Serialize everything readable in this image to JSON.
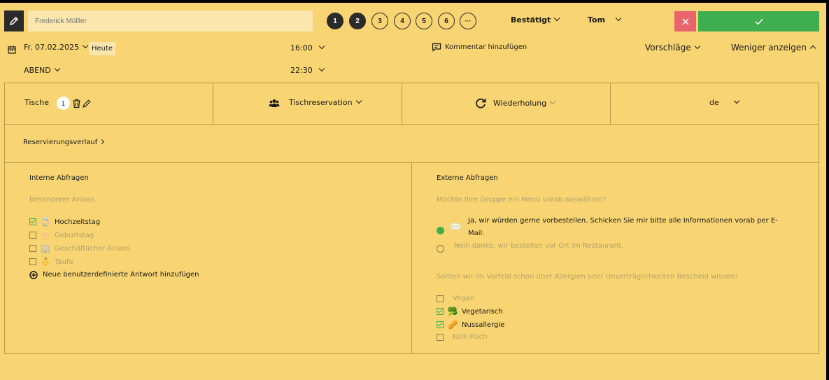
{
  "header": {
    "name_placeholder": "Frederick Mülller",
    "steps": [
      "1",
      "2",
      "3",
      "4",
      "5",
      "6",
      "···"
    ],
    "status": "Bestätigt",
    "staff": "Tom"
  },
  "datetime": {
    "date": "Fr. 07.02.2025",
    "today_label": "Heute",
    "shift": "ABEND",
    "start_time": "16:00",
    "end_time": "22:30",
    "comment_label": "Kommentar hinzufügen",
    "suggestions_label": "Vorschläge",
    "show_less_label": "Weniger anzeigen"
  },
  "details": {
    "tables_label": "Tische",
    "tables_count": "1",
    "type_label": "Tischreservation",
    "repeat_label": "Wiederholung",
    "language": "de"
  },
  "history_label": "Reservierungsverlauf",
  "internal": {
    "title": "Interne Abfragen",
    "question": "Besonderer Anlass",
    "options": [
      {
        "label": "Hochzeitstag",
        "checked": true,
        "icon": "ring-icon"
      },
      {
        "label": "Geburtstag",
        "checked": false,
        "icon": "cake-icon"
      },
      {
        "label": "Geschäftlicher Anlass",
        "checked": false,
        "icon": "office-icon"
      },
      {
        "label": "Taufe",
        "checked": false,
        "icon": "baby-icon"
      }
    ],
    "add_label": "Neue benutzerdefinierte Antwort hinzufügen"
  },
  "external": {
    "title": "Externe Abfragen",
    "question1": "Möchte Ihre Gruppe ein Menü vorab auswählen?",
    "answer_yes_line1": "Ja, wir würden gerne vorbestellen. Schicken Sie mir bitte alle Informationen vorab per E-",
    "answer_yes_line2": "Mail.",
    "answer_no": "Nein danke, wir bestellen vor Ort im Restaurant.",
    "question2": "Sollten wir im Vorfeld schon über Allergien oder Unverträglichkeiten Bescheid wissen?",
    "options": [
      {
        "label": "Vegan",
        "checked": false
      },
      {
        "label": "Vegetarisch",
        "checked": true,
        "icon": "broccoli-icon"
      },
      {
        "label": "Nussallergie",
        "checked": true,
        "icon": "peanut-icon"
      },
      {
        "label": "Kein Fisch",
        "checked": false
      }
    ]
  },
  "colors": {
    "background": "#f8d572",
    "confirm": "#3fae4f",
    "cancel": "#e9656b",
    "dark": "#2b2b2b"
  }
}
